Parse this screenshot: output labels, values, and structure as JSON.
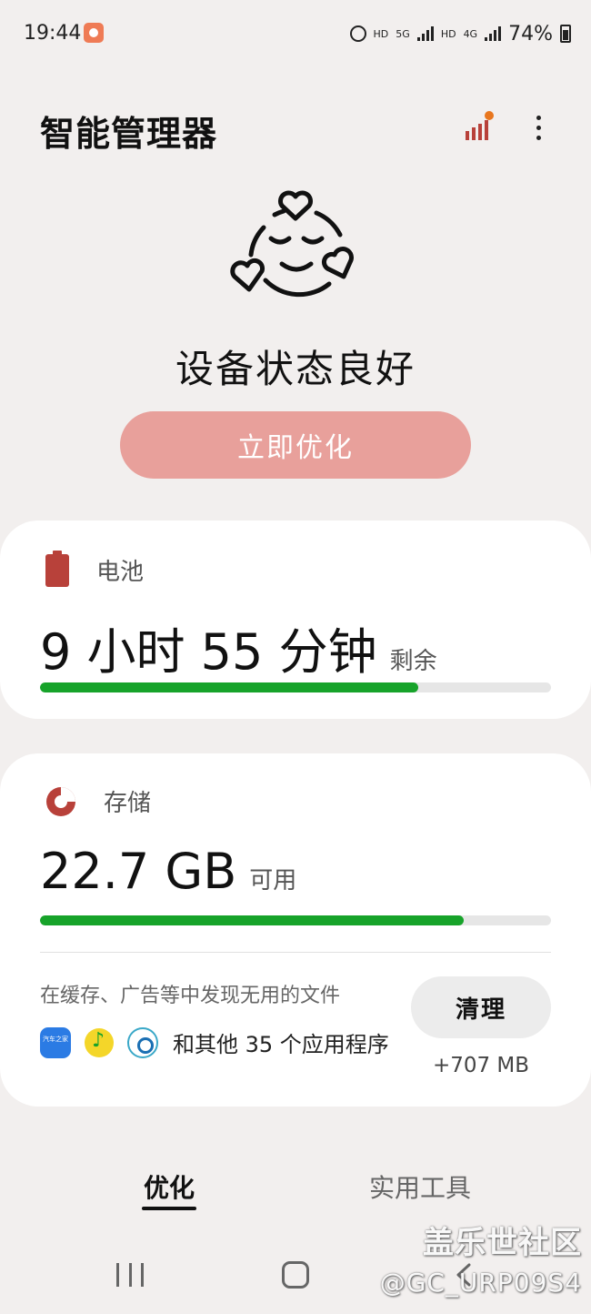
{
  "status_bar": {
    "time": "19:44",
    "hd1": "HD",
    "net1": "5G",
    "hd2": "HD",
    "net2": "4G",
    "battery_percent": "74%"
  },
  "header": {
    "title": "智能管理器",
    "accent_color": "#e8761e"
  },
  "hero": {
    "status_text": "设备状态良好",
    "optimize_button": "立即优化",
    "button_color": "#e8a09b"
  },
  "battery": {
    "label": "电池",
    "value": "9 小时 55 分钟",
    "suffix": "剩余",
    "progress": 0.74,
    "icon": "battery-icon",
    "icon_color": "#b8413a"
  },
  "storage": {
    "label": "存储",
    "value": "22.7 GB",
    "suffix": "可用",
    "progress": 0.83,
    "icon": "pie-chart-icon",
    "junk_text": "在缓存、广告等中发现无用的文件",
    "apps": [
      "汽车之家",
      "QQ音乐",
      "network-app"
    ],
    "others_text": "和其他 35 个应用程序",
    "clean_button": "清理",
    "clean_size": "+707 MB"
  },
  "tabs": [
    {
      "label": "优化",
      "active": true
    },
    {
      "label": "实用工具",
      "active": false
    }
  ],
  "progress_color": "#17a32a",
  "watermark": {
    "line1": "盖乐世社区",
    "line2": "@GC_URP09S4"
  }
}
